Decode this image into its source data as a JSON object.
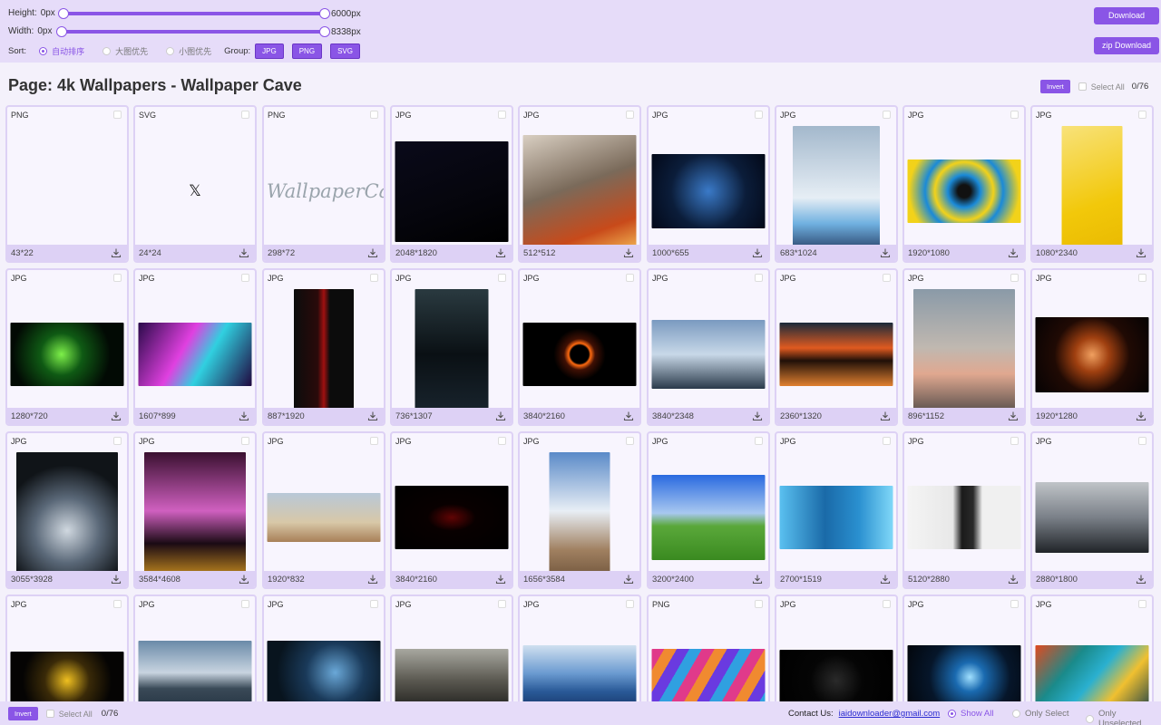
{
  "controls": {
    "height_label": "Height:",
    "height_min": "0px",
    "height_max": "6000px",
    "width_label": "Width:",
    "width_min": "0px",
    "width_max": "8338px",
    "sort_label": "Sort:",
    "sort_options": [
      "自动排序",
      "大图优先",
      "小图优先"
    ],
    "group_label": "Group:",
    "group_tags": [
      "JPG",
      "PNG",
      "SVG"
    ],
    "download_label": "Download",
    "zip_label": "zip Download"
  },
  "page": {
    "title": "Page:  4k Wallpapers - Wallpaper Cave",
    "invert_label": "Invert",
    "select_all_label": "Select All",
    "count": "0/76"
  },
  "cards": [
    {
      "type": "PNG",
      "dims": "43*22",
      "thumb": "blank"
    },
    {
      "type": "SVG",
      "dims": "24*24",
      "thumb": "x-logo"
    },
    {
      "type": "PNG",
      "dims": "298*72",
      "thumb": "wallpapercave-logo",
      "logo_text": "WallpaperCave"
    },
    {
      "type": "JPG",
      "dims": "2048*1820",
      "thumb": "dark"
    },
    {
      "type": "JPG",
      "dims": "512*512",
      "thumb": "anime"
    },
    {
      "type": "JPG",
      "dims": "1000*655",
      "thumb": "shiva"
    },
    {
      "type": "JPG",
      "dims": "683*1024",
      "thumb": "footballer"
    },
    {
      "type": "JPG",
      "dims": "1920*1080",
      "thumb": "spiral"
    },
    {
      "type": "JPG",
      "dims": "1080*2340",
      "thumb": "yellow"
    },
    {
      "type": "JPG",
      "dims": "1280*720",
      "thumb": "matrix"
    },
    {
      "type": "JPG",
      "dims": "1607*899",
      "thumb": "neon"
    },
    {
      "type": "JPG",
      "dims": "887*1920",
      "thumb": "batman"
    },
    {
      "type": "JPG",
      "dims": "736*1307",
      "thumb": "hacker"
    },
    {
      "type": "JPG",
      "dims": "3840*2160",
      "thumb": "eclipse"
    },
    {
      "type": "JPG",
      "dims": "3840*2348",
      "thumb": "dragon"
    },
    {
      "type": "JPG",
      "dims": "2360*1320",
      "thumb": "sunset-sea"
    },
    {
      "type": "JPG",
      "dims": "896*1152",
      "thumb": "car-road"
    },
    {
      "type": "JPG",
      "dims": "1920*1280",
      "thumb": "nebula"
    },
    {
      "type": "JPG",
      "dims": "3055*3928",
      "thumb": "supercar"
    },
    {
      "type": "JPG",
      "dims": "3584*4608",
      "thumb": "pink-car"
    },
    {
      "type": "JPG",
      "dims": "1920*832",
      "thumb": "desert"
    },
    {
      "type": "JPG",
      "dims": "3840*2160",
      "thumb": "black-red"
    },
    {
      "type": "JPG",
      "dims": "1656*3584",
      "thumb": "sky-figure"
    },
    {
      "type": "JPG",
      "dims": "3200*2400",
      "thumb": "bliss"
    },
    {
      "type": "JPG",
      "dims": "2700*1519",
      "thumb": "blue-face"
    },
    {
      "type": "JPG",
      "dims": "5120*2880",
      "thumb": "woman"
    },
    {
      "type": "JPG",
      "dims": "2880*1800",
      "thumb": "scifi"
    },
    {
      "type": "JPG",
      "dims": "",
      "thumb": "cracks"
    },
    {
      "type": "JPG",
      "dims": "",
      "thumb": "coast"
    },
    {
      "type": "JPG",
      "dims": "",
      "thumb": "blue-dragon"
    },
    {
      "type": "JPG",
      "dims": "",
      "thumb": "muscle-car"
    },
    {
      "type": "JPG",
      "dims": "",
      "thumb": "mountains"
    },
    {
      "type": "PNG",
      "dims": "",
      "thumb": "stripes"
    },
    {
      "type": "JPG",
      "dims": "",
      "thumb": "dark-scene"
    },
    {
      "type": "JPG",
      "dims": "",
      "thumb": "galaxy"
    },
    {
      "type": "JPG",
      "dims": "",
      "thumb": "fluid"
    }
  ],
  "footer": {
    "invert_label": "Invert",
    "select_all_label": "Select All",
    "count": "0/76",
    "contact_label": "Contact Us:",
    "contact_email": "iaidownloader@gmail.com",
    "filters": [
      "Show All",
      "Only Select",
      "Only Unselected"
    ]
  },
  "colors": {
    "accent": "#8a55e6",
    "header_bg": "#e6dcf9",
    "card_border": "#ddd1f5"
  }
}
